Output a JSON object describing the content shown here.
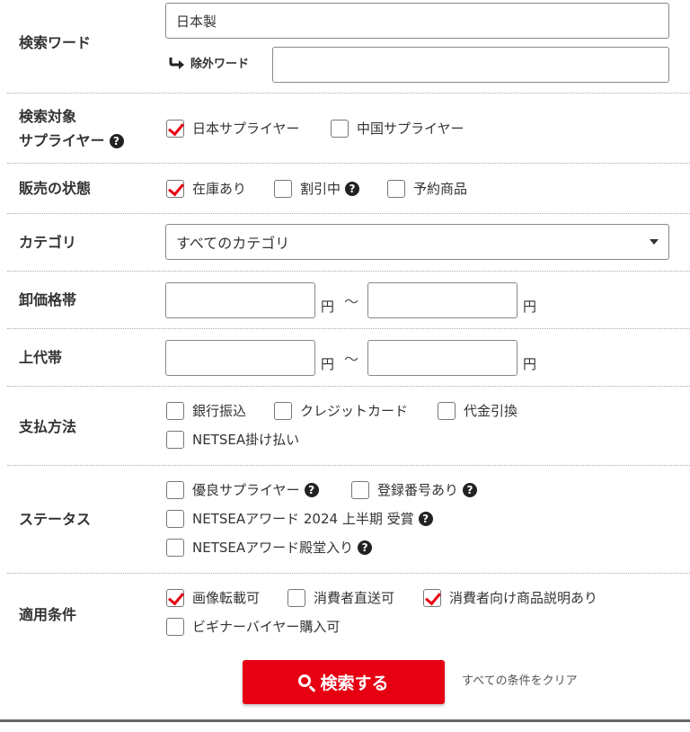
{
  "keyword": {
    "label": "検索ワード",
    "value": "日本製",
    "exclude_label": "除外ワード",
    "exclude_value": ""
  },
  "supplier": {
    "label_line1": "検索対象",
    "label_line2": "サプライヤー",
    "options": [
      {
        "label": "日本サプライヤー",
        "checked": true
      },
      {
        "label": "中国サプライヤー",
        "checked": false
      }
    ]
  },
  "sales_state": {
    "label": "販売の状態",
    "options": [
      {
        "label": "在庫あり",
        "checked": true
      },
      {
        "label": "割引中",
        "checked": false
      },
      {
        "label": "予約商品",
        "checked": false
      }
    ]
  },
  "category": {
    "label": "カテゴリ",
    "selected": "すべてのカテゴリ"
  },
  "wholesale_price": {
    "label": "卸価格帯",
    "unit": "円",
    "sep": "〜",
    "min": "",
    "max": ""
  },
  "retail_price": {
    "label": "上代帯",
    "unit": "円",
    "sep": "〜",
    "min": "",
    "max": ""
  },
  "payment": {
    "label": "支払方法",
    "options": [
      {
        "label": "銀行振込",
        "checked": false
      },
      {
        "label": "クレジットカード",
        "checked": false
      },
      {
        "label": "代金引換",
        "checked": false
      },
      {
        "label": "NETSEA掛け払い",
        "checked": false
      }
    ]
  },
  "status": {
    "label": "ステータス",
    "options": [
      {
        "label": "優良サプライヤー",
        "checked": false
      },
      {
        "label": "登録番号あり",
        "checked": false
      },
      {
        "label": "NETSEAアワード 2024 上半期 受賞",
        "checked": false
      },
      {
        "label": "NETSEAアワード殿堂入り",
        "checked": false
      }
    ]
  },
  "conditions": {
    "label": "適用条件",
    "options": [
      {
        "label": "画像転載可",
        "checked": true
      },
      {
        "label": "消費者直送可",
        "checked": false
      },
      {
        "label": "消費者向け商品説明あり",
        "checked": true
      },
      {
        "label": "ビギナーバイヤー購入可",
        "checked": false
      }
    ]
  },
  "actions": {
    "search_label": "検索する",
    "clear_label": "すべての条件をクリア"
  },
  "help_glyph": "?",
  "colors": {
    "accent": "#e60012",
    "border": "#888888",
    "text": "#333333"
  }
}
